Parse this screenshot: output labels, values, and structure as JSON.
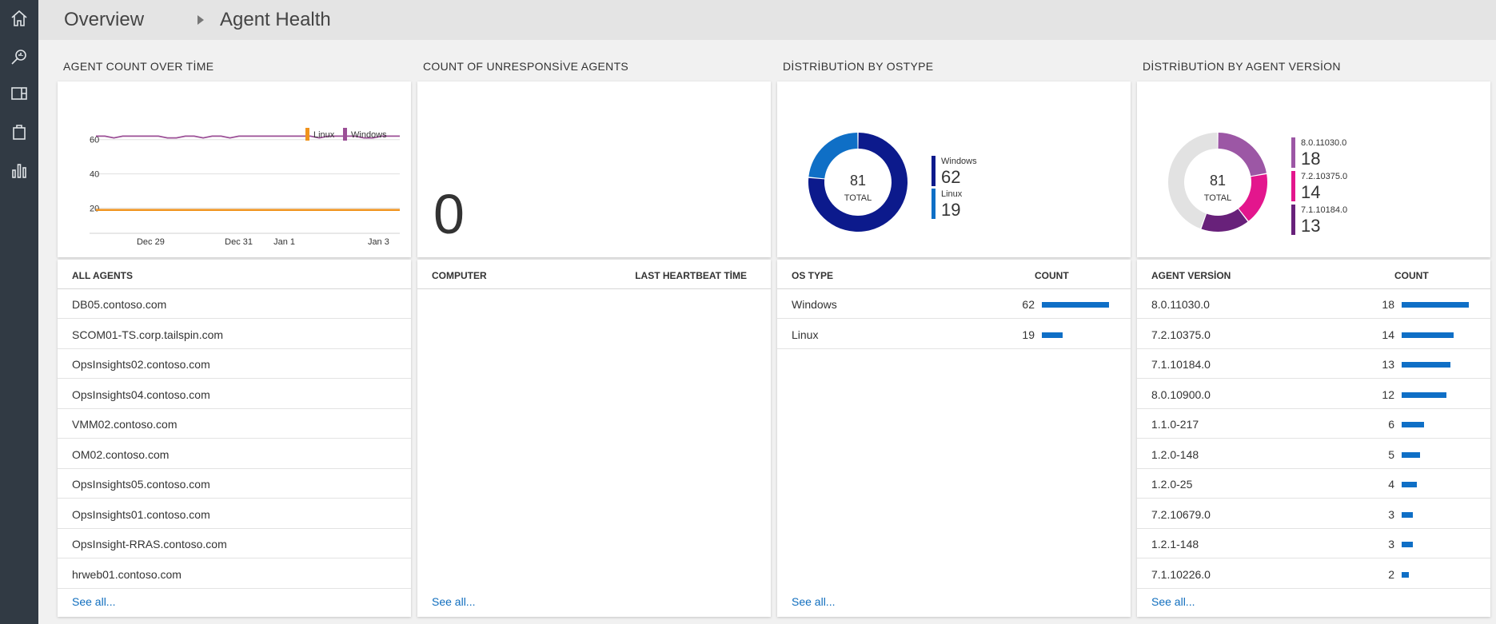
{
  "rail": {
    "icons": [
      "home-icon",
      "search-icon",
      "layout-icon",
      "solutions-icon",
      "chart-icon"
    ]
  },
  "breadcrumb": {
    "root": "Overview",
    "current": "Agent Health"
  },
  "agent_count_tile": {
    "title": "AGENT COUNT OVER TİME",
    "legend": [
      "Linux",
      "Windows"
    ],
    "colors": {
      "Linux": "#f0931d",
      "Windows": "#9b4f96"
    },
    "chart_data": {
      "type": "line",
      "x_tick_labels": [
        "Dec 29",
        "Dec 31",
        "Jan 1",
        "Jan 3"
      ],
      "y_tick_labels": [
        "60",
        "40",
        "20"
      ],
      "ylim": [
        10,
        65
      ],
      "series": [
        {
          "name": "Windows",
          "values": [
            62,
            62,
            61,
            62,
            62,
            62,
            62,
            62,
            61,
            61,
            62,
            62,
            61,
            62,
            62,
            61,
            62,
            62,
            62,
            62,
            62,
            62,
            62,
            62,
            62,
            61,
            62,
            62,
            62,
            62,
            61,
            61,
            62,
            62,
            62
          ]
        },
        {
          "name": "Linux",
          "values": [
            19,
            19,
            19,
            19,
            19,
            19,
            19,
            19,
            19,
            19,
            19,
            19,
            19,
            19,
            19,
            19,
            19,
            19,
            19,
            19,
            19,
            19,
            19,
            19,
            19,
            19,
            19,
            19,
            19,
            19,
            19,
            19,
            19,
            19,
            19
          ]
        }
      ]
    },
    "list_header": "ALL AGENTS",
    "agents": [
      "DB05.contoso.com",
      "SCOM01-TS.corp.tailspin.com",
      "OpsInsights02.contoso.com",
      "OpsInsights04.contoso.com",
      "VMM02.contoso.com",
      "OM02.contoso.com",
      "OpsInsights05.contoso.com",
      "OpsInsights01.contoso.com",
      "OpsInsight-RRAS.contoso.com",
      "hrweb01.contoso.com"
    ],
    "see_all": "See all..."
  },
  "unresponsive_tile": {
    "title": "COUNT OF UNRESPONSİVE AGENTS",
    "count": "0",
    "col_computer": "COMPUTER",
    "col_heartbeat": "LAST HEARTBEAT TİME",
    "see_all": "See all..."
  },
  "ostype_tile": {
    "title": "DİSTRİBUTİON BY OSTYPE",
    "total": "81",
    "total_label": "TOTAL",
    "chart_data": {
      "type": "pie",
      "slices": [
        {
          "name": "Windows",
          "value": 62,
          "color": "#0c1a8c"
        },
        {
          "name": "Linux",
          "value": 19,
          "color": "#0f6fc6"
        }
      ]
    },
    "col_type": "OS TYPE",
    "col_count": "COUNT",
    "rows": [
      {
        "name": "Windows",
        "count": 62
      },
      {
        "name": "Linux",
        "count": 19
      }
    ],
    "see_all": "See all..."
  },
  "version_tile": {
    "title": "DİSTRİBUTİON BY AGENT VERSİON",
    "total": "81",
    "total_label": "TOTAL",
    "chart_data": {
      "type": "pie",
      "slices": [
        {
          "name": "8.0.11030.0",
          "value": 18,
          "color": "#9c57a5"
        },
        {
          "name": "7.2.10375.0",
          "value": 14,
          "color": "#e3168d"
        },
        {
          "name": "7.1.10184.0",
          "value": 13,
          "color": "#68217a"
        },
        {
          "name": "Other",
          "value": 36,
          "color": "#e2e2e2"
        }
      ]
    },
    "legend": [
      {
        "name": "8.0.11030.0",
        "value": "18",
        "color": "#9c57a5"
      },
      {
        "name": "7.2.10375.0",
        "value": "14",
        "color": "#e3168d"
      },
      {
        "name": "7.1.10184.0",
        "value": "13",
        "color": "#68217a"
      }
    ],
    "col_version": "AGENT VERSİON",
    "col_count": "COUNT",
    "rows": [
      {
        "name": "8.0.11030.0",
        "count": 18
      },
      {
        "name": "7.2.10375.0",
        "count": 14
      },
      {
        "name": "7.1.10184.0",
        "count": 13
      },
      {
        "name": "8.0.10900.0",
        "count": 12
      },
      {
        "name": "1.1.0-217",
        "count": 6
      },
      {
        "name": "1.2.0-148",
        "count": 5
      },
      {
        "name": "1.2.0-25",
        "count": 4
      },
      {
        "name": "7.2.10679.0",
        "count": 3
      },
      {
        "name": "1.2.1-148",
        "count": 3
      },
      {
        "name": "7.1.10226.0",
        "count": 2
      }
    ],
    "see_all": "See all..."
  }
}
